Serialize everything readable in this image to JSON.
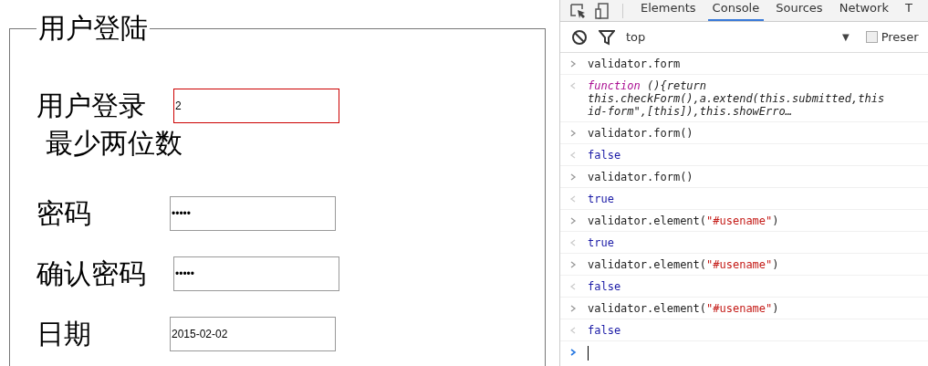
{
  "form": {
    "legend": "用户登陆",
    "fields": [
      {
        "label": "用户登录",
        "value": "2",
        "invalid": true,
        "error": "最少两位数"
      },
      {
        "label": "密码",
        "value": "•••••",
        "invalid": false
      },
      {
        "label": "确认密码",
        "value": "•••••",
        "invalid": false
      },
      {
        "label": "日期",
        "value": "2015-02-02",
        "invalid": false
      }
    ]
  },
  "devtools": {
    "tabs": [
      {
        "label": "Elements",
        "selected": false
      },
      {
        "label": "Console",
        "selected": true
      },
      {
        "label": "Sources",
        "selected": false
      },
      {
        "label": "Network",
        "selected": false
      },
      {
        "label": "T",
        "selected": false
      }
    ],
    "context": "top",
    "context_caret": "▼",
    "preserve_log": {
      "label": "Preser",
      "checked": false
    },
    "entries": [
      {
        "kind": "input",
        "segments": [
          {
            "kind": "plain",
            "text": "validator.form"
          }
        ]
      },
      {
        "kind": "result",
        "segments": [
          {
            "kind": "keyword",
            "text": "function"
          },
          {
            "kind": "italic",
            "text": " (){return\nthis.checkForm(),a.extend(this.submitted,this\nid-form\",[this]),this.showErro…"
          }
        ]
      },
      {
        "kind": "input",
        "segments": [
          {
            "kind": "plain",
            "text": "validator.form()"
          }
        ]
      },
      {
        "kind": "result",
        "segments": [
          {
            "kind": "value",
            "text": "false"
          }
        ]
      },
      {
        "kind": "input",
        "segments": [
          {
            "kind": "plain",
            "text": "validator.form()"
          }
        ]
      },
      {
        "kind": "result",
        "segments": [
          {
            "kind": "value",
            "text": "true"
          }
        ]
      },
      {
        "kind": "input",
        "segments": [
          {
            "kind": "plain",
            "text": "validator.element("
          },
          {
            "kind": "string",
            "text": "\"#usename\""
          },
          {
            "kind": "plain",
            "text": ")"
          }
        ]
      },
      {
        "kind": "result",
        "segments": [
          {
            "kind": "value",
            "text": "true"
          }
        ]
      },
      {
        "kind": "input",
        "segments": [
          {
            "kind": "plain",
            "text": "validator.element("
          },
          {
            "kind": "string",
            "text": "\"#usename\""
          },
          {
            "kind": "plain",
            "text": ")"
          }
        ]
      },
      {
        "kind": "result",
        "segments": [
          {
            "kind": "value",
            "text": "false"
          }
        ]
      },
      {
        "kind": "input",
        "segments": [
          {
            "kind": "plain",
            "text": "validator.element("
          },
          {
            "kind": "string",
            "text": "\"#usename\""
          },
          {
            "kind": "plain",
            "text": ")"
          }
        ]
      },
      {
        "kind": "result",
        "segments": [
          {
            "kind": "value",
            "text": "false"
          }
        ]
      }
    ]
  }
}
